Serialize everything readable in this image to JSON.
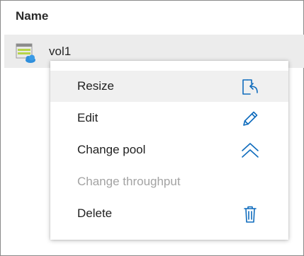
{
  "table": {
    "column_name": "Name",
    "rows": [
      {
        "name": "vol1",
        "icon": "volume-cloud-icon"
      }
    ]
  },
  "context_menu": {
    "accent_color": "#0f6cbd",
    "items": [
      {
        "label": "Resize",
        "icon": "resize-icon",
        "enabled": true,
        "hovered": true
      },
      {
        "label": "Edit",
        "icon": "pencil-icon",
        "enabled": true,
        "hovered": false
      },
      {
        "label": "Change pool",
        "icon": "chevron-double-up-icon",
        "enabled": true,
        "hovered": false
      },
      {
        "label": "Change throughput",
        "icon": null,
        "enabled": false,
        "hovered": false
      },
      {
        "label": "Delete",
        "icon": "trash-icon",
        "enabled": true,
        "hovered": false
      }
    ]
  }
}
